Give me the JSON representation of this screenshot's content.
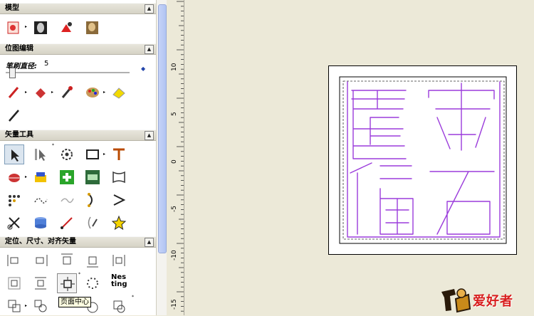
{
  "sections": {
    "model": {
      "title": "模型"
    },
    "bitmap_edit": {
      "title": "位图编辑",
      "brush_label": "笔刷直径:",
      "brush_value": "5"
    },
    "vector_tools": {
      "title": "矢量工具"
    },
    "align": {
      "title": "定位、尺寸、对齐矢量"
    }
  },
  "ruler": {
    "labels": [
      "10",
      "5",
      "0",
      "-5",
      "-10",
      "-15"
    ]
  },
  "tooltip": {
    "text": "页面中心"
  },
  "nesting_icon_text": "Nes\nting",
  "seal": {
    "characters": [
      "宋",
      "石",
      "書",
      "福"
    ],
    "stroke_color": "#9b3cdb"
  },
  "logo": {
    "text": "爱好者"
  },
  "colors": {
    "panel_bg": "#ffffff",
    "workspace": "#ece9d8",
    "accent": "#9b3cdb"
  }
}
